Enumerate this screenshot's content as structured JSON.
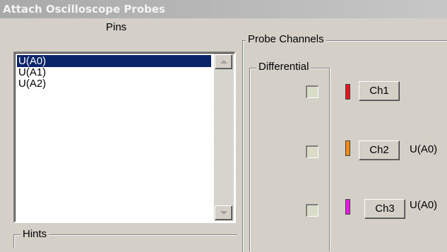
{
  "window": {
    "title": "Attach Oscilloscope Probes"
  },
  "pins": {
    "label": "Pins",
    "items": [
      "U(A0)",
      "U(A1)",
      "U(A2)"
    ],
    "selected_index": 0
  },
  "hints": {
    "label": "Hints"
  },
  "probe_channels": {
    "label": "Probe Channels",
    "differential_label": "Differential",
    "channels": [
      {
        "button_label": "Ch1",
        "color": "#e8141c",
        "assigned_pin": ""
      },
      {
        "button_label": "Ch2",
        "color": "#f08c14",
        "assigned_pin": "U(A0)"
      },
      {
        "button_label": "Ch3",
        "color": "#e818e8",
        "assigned_pin": "U(A0)"
      }
    ]
  },
  "colors": {
    "selection": "#0a246a",
    "face": "#d4d0c8",
    "checkbox_fill": "#d9dcc6"
  }
}
